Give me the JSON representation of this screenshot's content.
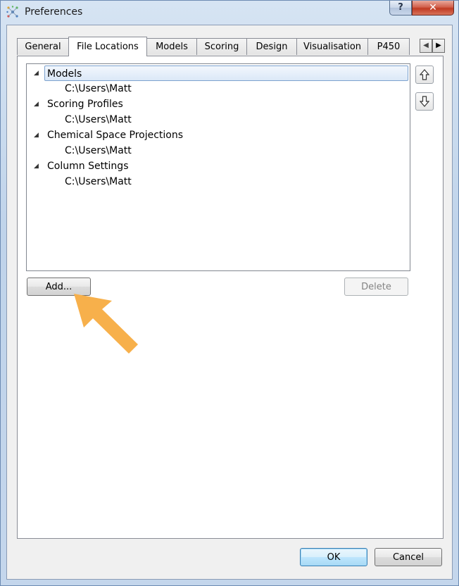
{
  "window": {
    "title": "Preferences",
    "help_label": "?",
    "close_label": "✕"
  },
  "tabs": [
    {
      "label": "General"
    },
    {
      "label": "File Locations"
    },
    {
      "label": "Models"
    },
    {
      "label": "Scoring"
    },
    {
      "label": "Design"
    },
    {
      "label": "Visualisation"
    },
    {
      "label": "P450"
    }
  ],
  "active_tab": "File Locations",
  "tree": {
    "groups": [
      {
        "label": "Models",
        "path": "C:\\Users\\Matt",
        "expanded": true,
        "selected": true
      },
      {
        "label": "Scoring Profiles",
        "path": "C:\\Users\\Matt",
        "expanded": true,
        "selected": false
      },
      {
        "label": "Chemical Space Projections",
        "path": "C:\\Users\\Matt",
        "expanded": true,
        "selected": false
      },
      {
        "label": "Column Settings",
        "path": "C:\\Users\\Matt",
        "expanded": true,
        "selected": false
      }
    ]
  },
  "buttons": {
    "add": "Add...",
    "delete": "Delete",
    "ok": "OK",
    "cancel": "Cancel"
  },
  "icons": {
    "move_up": "arrow-up-icon",
    "move_down": "arrow-down-icon",
    "tab_scroll_left": "chevron-left-icon",
    "tab_scroll_right": "chevron-right-icon"
  },
  "colors": {
    "annotation_arrow": "#f7b04b",
    "selection_border": "#7da2ce",
    "close_button": "#c03a22"
  }
}
